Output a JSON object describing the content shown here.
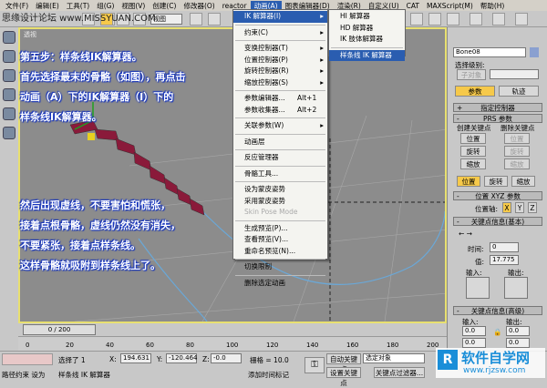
{
  "menubar": [
    "文件(F)",
    "编辑(E)",
    "工具(T)",
    "组(G)",
    "视图(V)",
    "创建(C)",
    "修改器(O)",
    "reactor",
    "动画(A)",
    "图表编辑器(D)",
    "渲染(R)",
    "自定义(U)",
    "CAT",
    "MAXScript(M)",
    "帮助(H)"
  ],
  "watermark_top": "思缘设计论坛 www.MISSYUAN.COM",
  "toolbar": {
    "view_select": "视图"
  },
  "viewport": {
    "label": "透视",
    "notes": [
      "第五步：样条线IK解算器。",
      "首先选择最末的骨骼（如图），再点击",
      "动画（A）下的IK解算器（I）下的",
      "样条线IK解算器。",
      "然后出现虚线，不要害怕和慌张，",
      "接着点根骨骼，虚线仍然没有消失，",
      "不要紧张，接着点样条线。",
      "这样骨骼就吸附到样条线上了。"
    ]
  },
  "anim_menu": [
    {
      "label": "IK 解算器(I)",
      "arrow": true,
      "hl": true
    },
    "-",
    {
      "label": "约束(C)",
      "arrow": true
    },
    "-",
    {
      "label": "变换控制器(T)",
      "arrow": true
    },
    {
      "label": "位置控制器(P)",
      "arrow": true
    },
    {
      "label": "旋转控制器(R)",
      "arrow": true
    },
    {
      "label": "缩放控制器(S)",
      "arrow": true
    },
    "-",
    {
      "label": "参数编辑器...",
      "sc": "Alt+1"
    },
    {
      "label": "参数收集器...",
      "sc": "Alt+2"
    },
    "-",
    {
      "label": "关联参数(W)",
      "arrow": true
    },
    "-",
    {
      "label": "动画层"
    },
    "-",
    {
      "label": "反应管理器"
    },
    "-",
    {
      "label": "骨骼工具..."
    },
    "-",
    {
      "label": "设为蒙皮姿势"
    },
    {
      "label": "采用蒙皮姿势"
    },
    {
      "label": "Skin Pose Mode",
      "dis": true
    },
    "-",
    {
      "label": "生成预览(P)..."
    },
    {
      "label": "查看预览(V)..."
    },
    {
      "label": "重命名预览(N)..."
    },
    "-",
    {
      "label": "切换限制"
    },
    "-",
    {
      "label": "删除选定动画"
    }
  ],
  "ik_submenu": [
    "HI 解算器",
    "HD 解算器",
    "IK 肢体解算器",
    "样条线 IK 解算器"
  ],
  "command_panel": {
    "object_name": "Bone08",
    "selection_level": "选择级别:",
    "sub_object": "子对象",
    "tabs": [
      "参数",
      "轨迹"
    ],
    "rollouts": {
      "assign": "指定控制器",
      "prs": "PRS 参数",
      "xyz": "位置 XYZ 参数",
      "key_basic": "关键点信息(基本)",
      "key_adv": "关键点信息(高级)"
    },
    "create_key": "创建关键点",
    "delete_key": "删除关键点",
    "key_buttons": [
      "位置",
      "旋转",
      "缩放"
    ],
    "mode_buttons": [
      "位置",
      "旋转",
      "缩放"
    ],
    "position_axis": "位置轴:",
    "axes": [
      "X",
      "Y",
      "Z"
    ],
    "time_label": "时间:",
    "time_value": "0",
    "value_label": "值:",
    "value_value": "17.775",
    "in_label": "输入:",
    "out_label": "输出:",
    "adv_in": [
      "0.0",
      "0.0"
    ],
    "adv_out": [
      "0.0",
      "0.0"
    ]
  },
  "timeline": {
    "frame": "0 / 200",
    "ticks": [
      "0",
      "20",
      "40",
      "60",
      "80",
      "100",
      "120",
      "140",
      "160",
      "180",
      "200"
    ]
  },
  "status": {
    "selected": "选择了 1",
    "x_label": "X:",
    "x": "194.631",
    "y_label": "Y:",
    "y": "-120.464",
    "z_label": "Z:",
    "z": "-0.0",
    "grid": "栅格 = 10.0",
    "prompt": "样条线 IK 解算器",
    "add_time_tag": "添加时间标记",
    "auto_key": "自动关键点",
    "set_key": "设置关键点",
    "selected_obj": "选定对象",
    "key_filters": "关键点过滤器...",
    "left_text": "路径约束 设为"
  },
  "watermark_bottom": {
    "name": "软件自学网",
    "url": "www.rjzsw.com"
  },
  "colors": {
    "accent": "#2a5db0",
    "yellow": "#f6c94a",
    "viewport": "#8c8c8c"
  }
}
